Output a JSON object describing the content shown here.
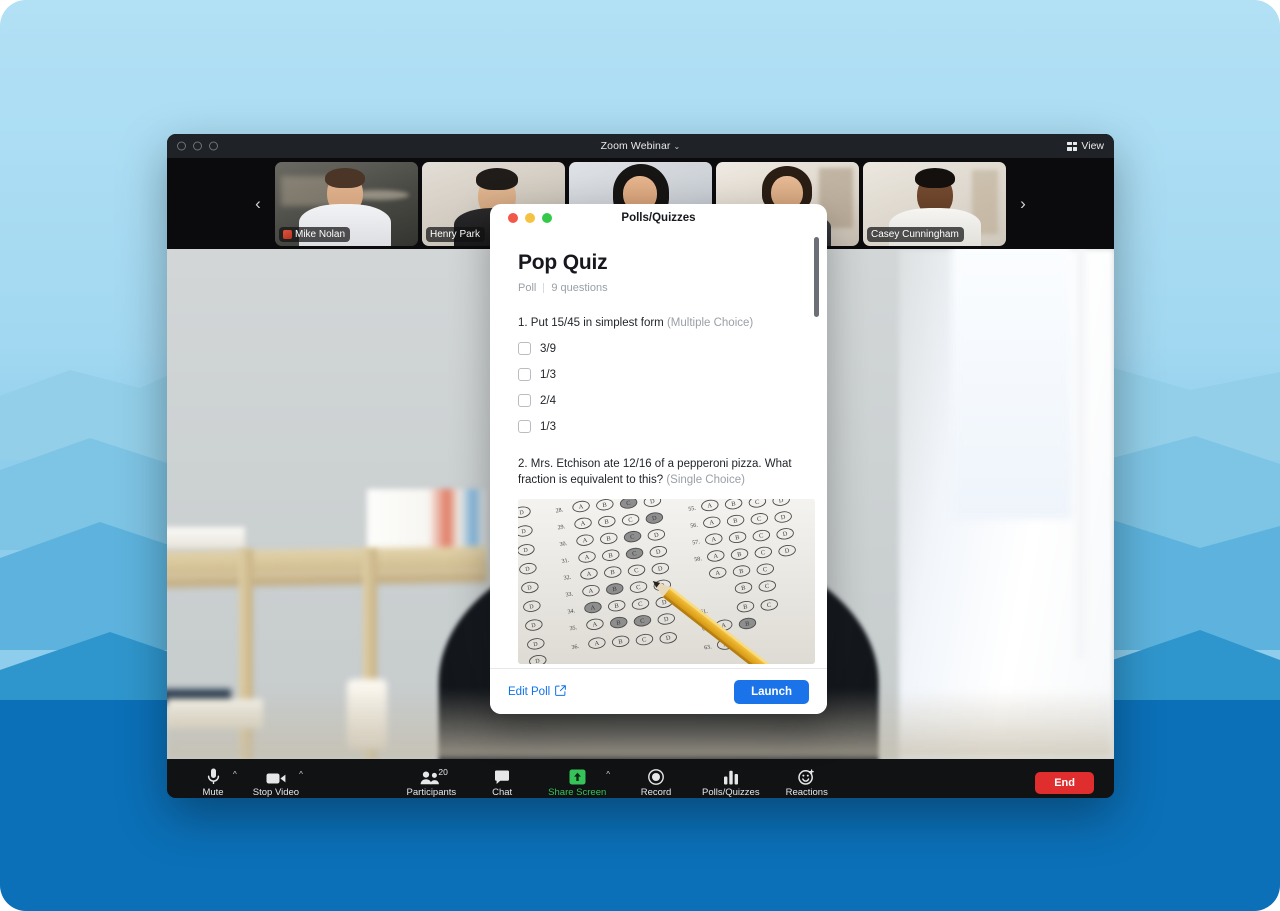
{
  "window": {
    "title": "Zoom Webinar",
    "title_caret": "⌄",
    "view_label": "View"
  },
  "filmstrip": {
    "prev_label": "‹",
    "next_label": "›",
    "participants": [
      {
        "name": "Mike Nolan",
        "has_badge": true
      },
      {
        "name": "Henry Park",
        "has_badge": false
      },
      {
        "name": "",
        "has_badge": false
      },
      {
        "name": "",
        "has_badge": false
      },
      {
        "name": "Casey Cunningham",
        "has_badge": false
      }
    ]
  },
  "controls": {
    "left": [
      {
        "label": "Mute",
        "icon": "microphone-icon",
        "has_caret": true
      },
      {
        "label": "Stop Video",
        "icon": "video-camera-icon",
        "has_caret": true
      }
    ],
    "center": [
      {
        "label": "Participants",
        "icon": "participants-icon",
        "count": "20",
        "has_caret": false
      },
      {
        "label": "Chat",
        "icon": "chat-bubble-icon",
        "has_caret": false
      },
      {
        "label": "Share Screen",
        "icon": "share-screen-icon",
        "has_caret": true,
        "active": true
      },
      {
        "label": "Record",
        "icon": "record-icon",
        "has_caret": false
      },
      {
        "label": "Polls/Quizzes",
        "icon": "bar-chart-icon",
        "has_caret": false
      },
      {
        "label": "Reactions",
        "icon": "reactions-smiley-icon",
        "has_caret": false
      }
    ],
    "end_label": "End"
  },
  "modal": {
    "title": "Polls/Quizzes",
    "poll_title": "Pop Quiz",
    "meta_type": "Poll",
    "meta_count": "9 questions",
    "questions": [
      {
        "number": "1.",
        "text": "Put 15/45 in simplest form",
        "type": "(Multiple Choice)",
        "options": [
          "3/9",
          "1/3",
          "2/4",
          "1/3"
        ]
      },
      {
        "number": "2.",
        "text": "Mrs. Etchison ate 12/16 of a pepperoni pizza. What fraction is equivalent to this?",
        "type": "(Single Choice)",
        "image": "scantron-answer-sheet-with-pencil"
      }
    ],
    "footer": {
      "edit_label": "Edit Poll",
      "edit_icon": "external-link-icon",
      "launch_label": "Launch"
    }
  },
  "colors": {
    "accent_blue": "#1a73e8",
    "link_blue": "#0e72ed",
    "end_red": "#e02d2d",
    "share_green": "#36c35a",
    "backdrop_blue": "#0b70b8"
  }
}
